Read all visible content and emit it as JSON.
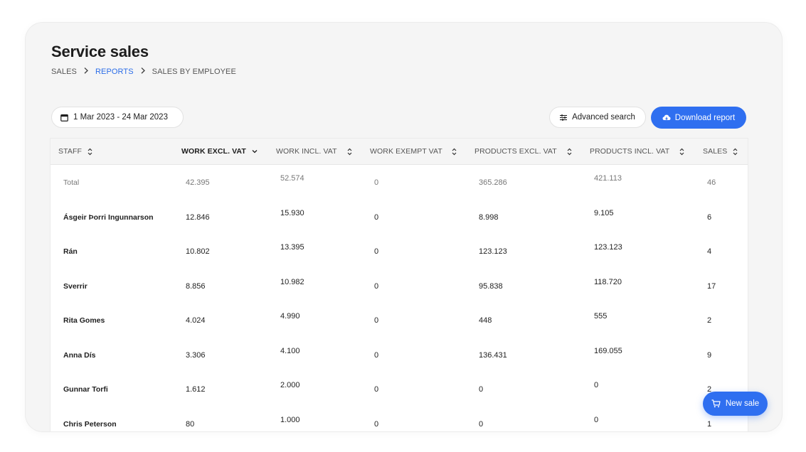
{
  "page": {
    "title": "Service sales"
  },
  "breadcrumb": {
    "items": [
      "SALES",
      "REPORTS",
      "SALES BY EMPLOYEE"
    ]
  },
  "filters": {
    "date_range": "1 Mar 2023 - 24 Mar 2023"
  },
  "toolbar": {
    "advanced_search_label": "Advanced search",
    "download_label": "Download report"
  },
  "table": {
    "columns": [
      "STAFF",
      "WORK EXCL. VAT",
      "WORK INCL. VAT",
      "WORK EXEMPT VAT",
      "PRODUCTS EXCL. VAT",
      "PRODUCTS INCL. VAT",
      "SALES"
    ],
    "sorted_column": "WORK EXCL. VAT",
    "rows": [
      [
        "Total",
        "42.395",
        "52.574",
        "0",
        "365.286",
        "421.113",
        "46"
      ],
      [
        "Ásgeir Þorri Ingunnarson",
        "12.846",
        "15.930",
        "0",
        "8.998",
        "9.105",
        "6"
      ],
      [
        "Rán",
        "10.802",
        "13.395",
        "0",
        "123.123",
        "123.123",
        "4"
      ],
      [
        "Sverrir",
        "8.856",
        "10.982",
        "0",
        "95.838",
        "118.720",
        "17"
      ],
      [
        "Rita Gomes",
        "4.024",
        "4.990",
        "0",
        "448",
        "555",
        "2"
      ],
      [
        "Anna Dís",
        "3.306",
        "4.100",
        "0",
        "136.431",
        "169.055",
        "9"
      ],
      [
        "Gunnar Torfi",
        "1.612",
        "2.000",
        "0",
        "0",
        "0",
        "2"
      ],
      [
        "Chris Peterson",
        "80",
        "1.000",
        "0",
        "0",
        "0",
        "1"
      ]
    ]
  },
  "fab": {
    "new_sale_label": "New sale"
  },
  "colors": {
    "accent": "#2f6ff0",
    "link": "#2b6de8",
    "window_bg": "#f5f5f5"
  },
  "icons": {
    "date": "calendar-icon",
    "advanced_search": "sliders-icon",
    "download": "cloud-download-icon",
    "sort": "sort-arrows-icon",
    "sort_active": "chevron-down-icon",
    "new_sale": "cart-icon"
  }
}
